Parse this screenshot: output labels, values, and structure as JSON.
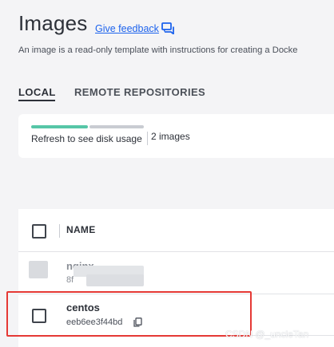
{
  "header": {
    "title": "Images",
    "feedback_label": "Give feedback",
    "description": "An image is a read-only template with instructions for creating a Docke"
  },
  "tabs": [
    {
      "label": "LOCAL",
      "active": true
    },
    {
      "label": "REMOTE REPOSITORIES",
      "active": false
    }
  ],
  "disk_usage": {
    "refresh_label": "Refresh to see disk usage",
    "image_count": "2 images",
    "bar_fill_fraction": 0.51
  },
  "table": {
    "columns": [
      "NAME"
    ],
    "rows": [
      {
        "name": "nginx",
        "id": "8f"
      },
      {
        "name": "centos",
        "id": "eeb6ee3f44bd"
      }
    ]
  },
  "watermark": "CSDN @_uncleTan",
  "colors": {
    "accent_link": "#1d63ed",
    "usage_bar": "#56c6a7",
    "highlight": "#e53935"
  }
}
